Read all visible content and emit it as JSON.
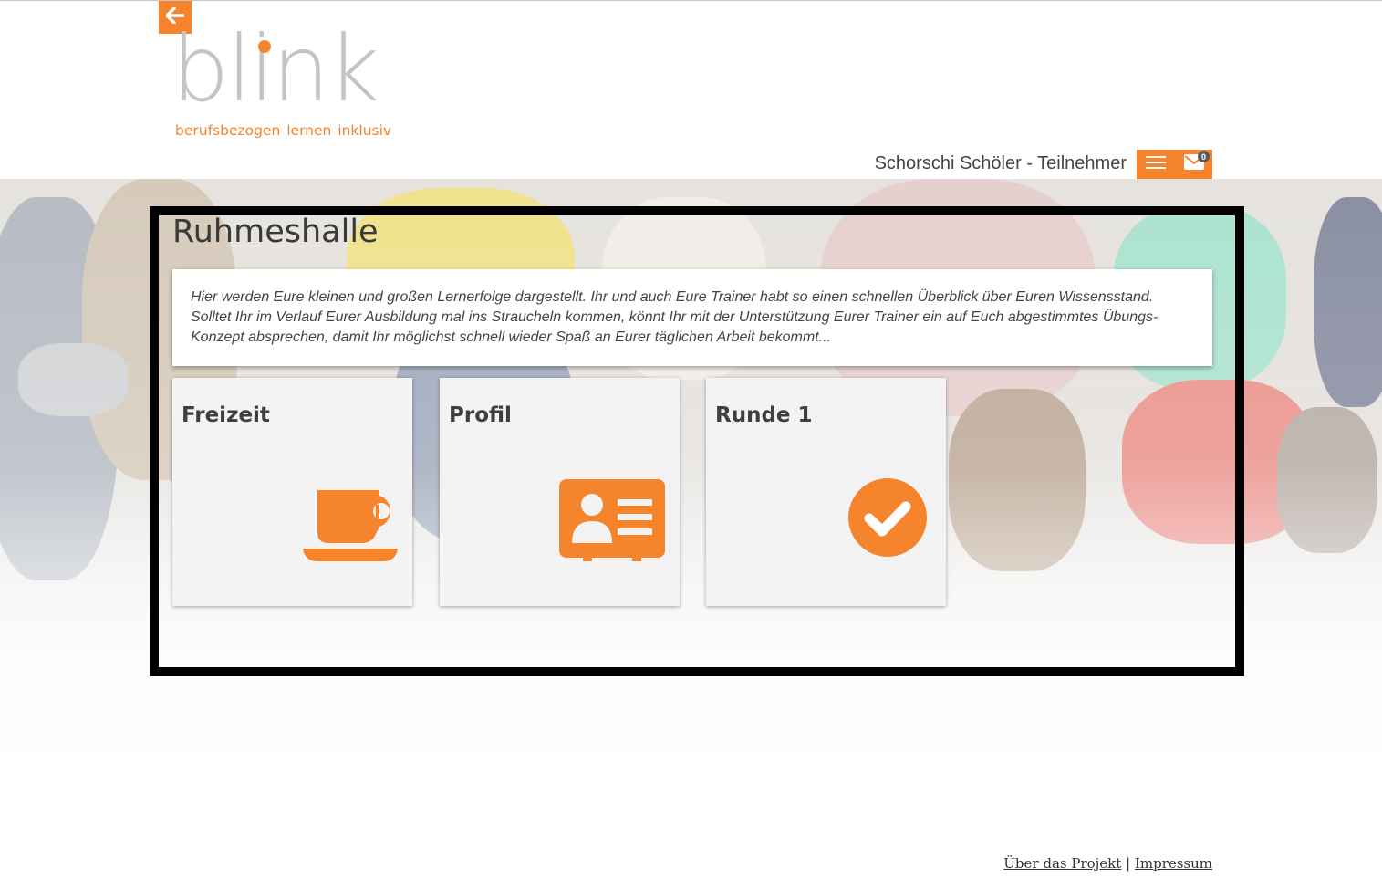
{
  "header": {
    "back_icon": "arrow-left-icon",
    "logo": {
      "word": "blink",
      "tagline": "berufsbezogen lernen inklusiv"
    },
    "user_label": "Schorschi Schöler - Teilnehmer",
    "menu_icon": "hamburger-icon",
    "mail_icon": "envelope-icon",
    "mail_count": "0"
  },
  "main": {
    "title": "Ruhmeshalle",
    "info": "Hier werden Eure kleinen und großen Lernerfolge dargestellt. Ihr und auch Eure Trainer habt so einen schnellen Überblick über Euren Wissensstand. Solltet Ihr im Verlauf Eurer Ausbildung mal ins Straucheln kommen, könnt Ihr mit der Unterstützung Eurer Trainer ein auf Euch abgestimmtes Übungs-Konzept absprechen, damit Ihr möglichst schnell wieder Spaß an Eurer täglichen Arbeit bekommt...",
    "tiles": [
      {
        "label": "Freizeit",
        "icon": "coffee-cup-icon"
      },
      {
        "label": "Profil",
        "icon": "id-card-icon"
      },
      {
        "label": "Runde 1",
        "icon": "check-circle-icon"
      }
    ]
  },
  "footer": {
    "about": "Über das Projekt",
    "separator": "|",
    "imprint": "Impressum"
  },
  "colors": {
    "accent": "#f5842d",
    "tile_bg": "#f3f3f3",
    "panel_border": "#000000"
  }
}
